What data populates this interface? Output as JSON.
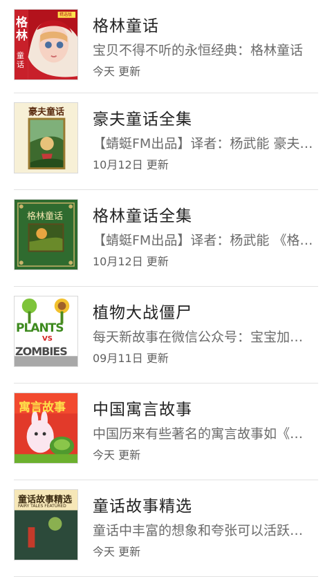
{
  "items": [
    {
      "title": "格林童话",
      "desc": "宝贝不得不听的永恒经典：格林童话",
      "updated": "今天 更新",
      "cover_icon": "grimm-fairy-tales-cover-icon",
      "cover_text": "格林",
      "cover_subtext": "童话",
      "cover_badge": "精选版"
    },
    {
      "title": "豪夫童话全集",
      "desc": "【蜻蜓FM出品】译者：杨武能 豪夫…",
      "updated": "10月12日 更新",
      "cover_icon": "hauff-fairy-tales-cover-icon",
      "cover_text": "豪夫童话"
    },
    {
      "title": "格林童话全集",
      "desc": "【蜻蜓FM出品】译者：杨武能 《格…",
      "updated": "10月12日 更新",
      "cover_icon": "grimm-complete-cover-icon",
      "cover_text": "格林童话"
    },
    {
      "title": "植物大战僵尸",
      "desc": "每天新故事在微信公众号：宝宝加…",
      "updated": "09月11日 更新",
      "cover_icon": "plants-vs-zombies-cover-icon",
      "cover_text": "PLANTS",
      "cover_vs": "VS",
      "cover_text2": "ZOMBIES"
    },
    {
      "title": "中国寓言故事",
      "desc": "中国历来有些著名的寓言故事如《…",
      "updated": "今天 更新",
      "cover_icon": "chinese-fables-cover-icon",
      "cover_text": "寓言故事"
    },
    {
      "title": "童话故事精选",
      "desc": "童话中丰富的想象和夸张可以活跃…",
      "updated": "今天 更新",
      "cover_icon": "fairy-tales-featured-cover-icon",
      "cover_text": "童话故事精选",
      "cover_subtext": "FAIRY TALES FEATURED"
    }
  ],
  "colors": {
    "title": "#222222",
    "desc": "#6b6b6b",
    "updated": "#5f5f5f",
    "divider": "#e2e2e2",
    "accent_red": "#c8202a",
    "accent_green": "#2f6b2f"
  }
}
